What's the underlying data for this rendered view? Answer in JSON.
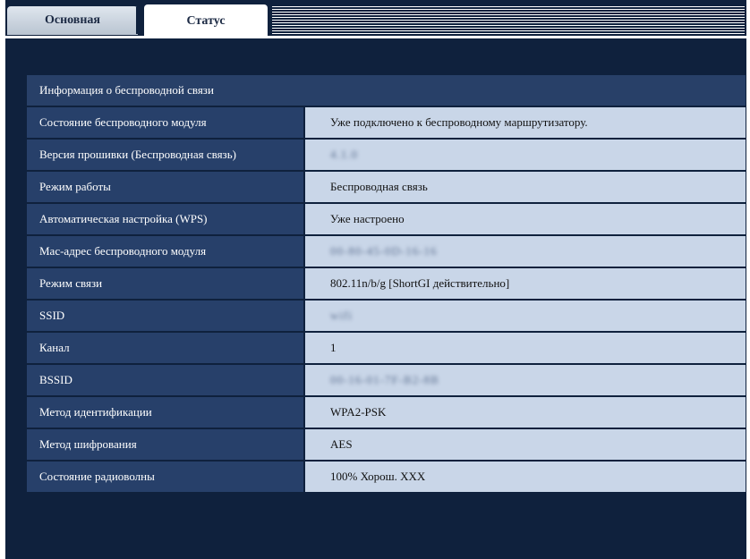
{
  "tabs": [
    {
      "label": "Основная",
      "active": false
    },
    {
      "label": "Статус",
      "active": true
    }
  ],
  "section": {
    "title": "Информация о беспроводной связи"
  },
  "rows": [
    {
      "label": "Состояние беспроводного модуля",
      "value": "Уже подключено к беспроводному маршрутизатору.",
      "blurred": false
    },
    {
      "label": "Версия прошивки (Беспроводная связь)",
      "value": "4.1.0",
      "blurred": true
    },
    {
      "label": "Режим работы",
      "value": "Беспроводная связь",
      "blurred": false
    },
    {
      "label": "Автоматическая настройка (WPS)",
      "value": "Уже настроено",
      "blurred": false
    },
    {
      "label": "Мас-адрес беспроводного модуля",
      "value": "00-80-45-0D-16-16",
      "blurred": true
    },
    {
      "label": "Режим связи",
      "value": "802.11n/b/g [ShortGI действительно]",
      "blurred": false
    },
    {
      "label": "SSID",
      "value": "wifi",
      "blurred": true
    },
    {
      "label": "Канал",
      "value": "1",
      "blurred": false
    },
    {
      "label": "BSSID",
      "value": "00-16-01-7F-B2-8B",
      "blurred": true
    },
    {
      "label": "Метод идентификации",
      "value": "WPA2-PSK",
      "blurred": false
    },
    {
      "label": "Метод шифрования",
      "value": "AES",
      "blurred": false
    },
    {
      "label": "Состояние радиоволны",
      "value": "100%  Хорош.    XXX",
      "blurred": false
    }
  ],
  "colors": {
    "background": "#0f213d",
    "label_bg": "#27406a",
    "value_bg": "#c9d6e8",
    "active_tab": "#ffffff"
  }
}
